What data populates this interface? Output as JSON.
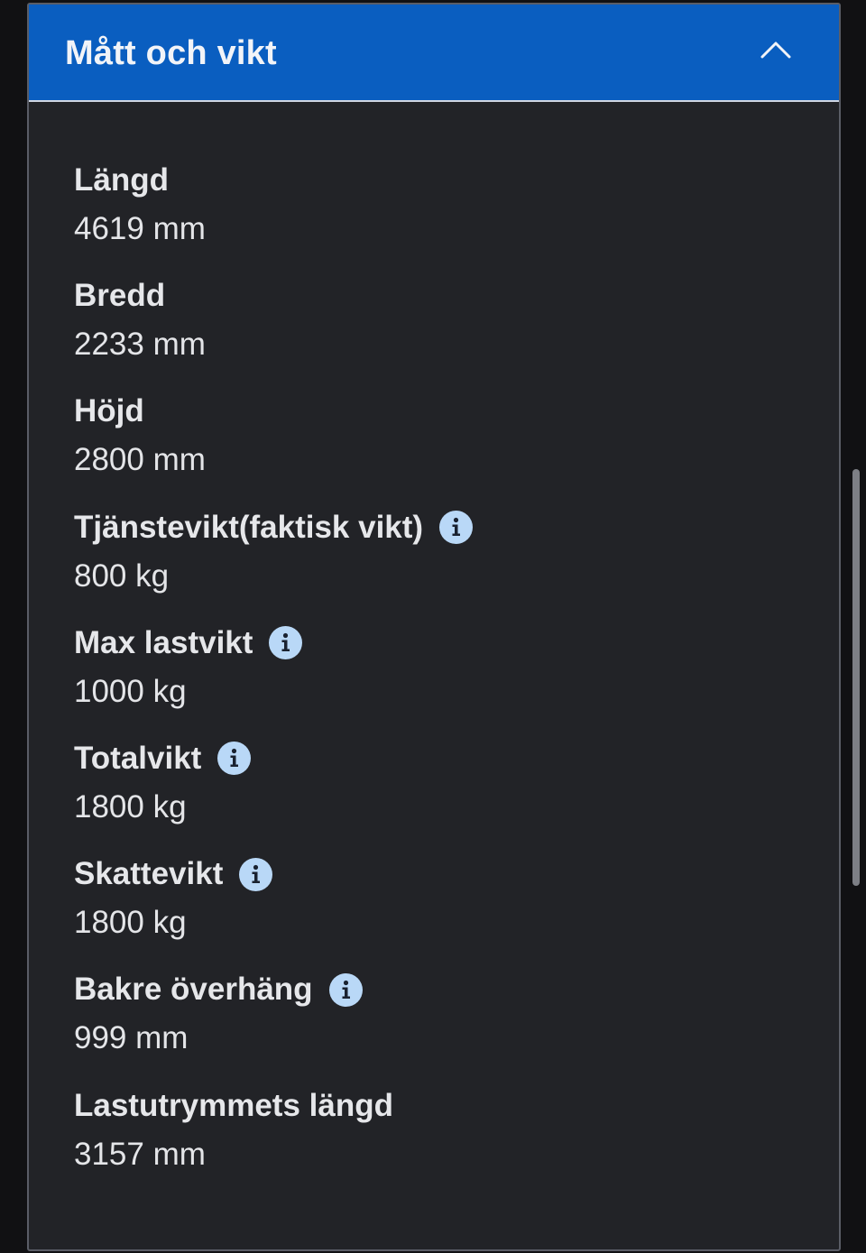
{
  "section": {
    "title": "Mått och vikt",
    "expanded": true,
    "chevron_icon": "chevron-up-icon",
    "header_color": "#0a5ec0"
  },
  "specs": [
    {
      "label": "Längd",
      "value": "4619 mm",
      "info": false
    },
    {
      "label": "Bredd",
      "value": "2233 mm",
      "info": false
    },
    {
      "label": "Höjd",
      "value": "2800 mm",
      "info": false
    },
    {
      "label": "Tjänstevikt(faktisk vikt)",
      "value": "800 kg",
      "info": true
    },
    {
      "label": "Max lastvikt",
      "value": "1000 kg",
      "info": true
    },
    {
      "label": "Totalvikt",
      "value": "1800 kg",
      "info": true
    },
    {
      "label": "Skattevikt",
      "value": "1800 kg",
      "info": true
    },
    {
      "label": "Bakre överhäng",
      "value": "999 mm",
      "info": true
    },
    {
      "label": "Lastutrymmets längd",
      "value": "3157 mm",
      "info": false
    }
  ],
  "colors": {
    "background": "#111113",
    "panel": "#222327",
    "info_icon": "#b9d8f7",
    "info_glyph": "#1a2230"
  }
}
